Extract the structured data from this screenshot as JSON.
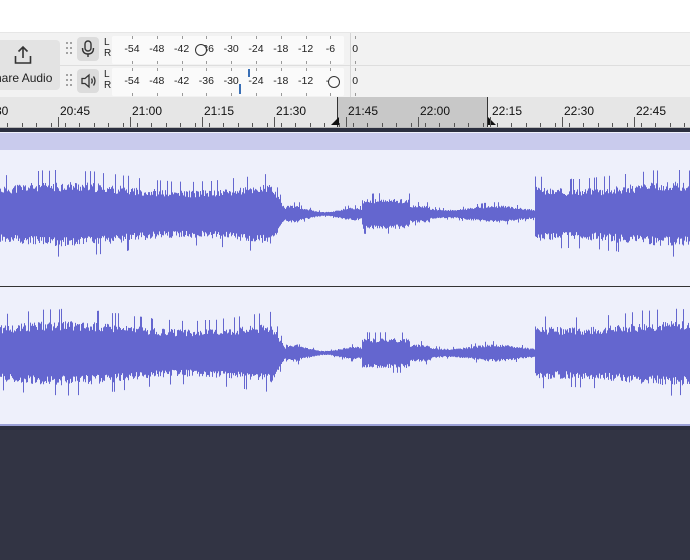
{
  "toolbar": {
    "share_label": "hare Audio",
    "icons": {
      "share": "share-upload-icon",
      "record_meter": "microphone-icon",
      "playback_meter": "speaker-icon"
    },
    "record_meter": {
      "channel_l": "L",
      "channel_r": "R",
      "ticks": [
        "-54",
        "-48",
        "-42",
        "-36",
        "-30",
        "-24",
        "-18",
        "-12",
        "-6",
        "0"
      ]
    },
    "playback_meter": {
      "channel_l": "L",
      "channel_r": "R",
      "ticks": [
        "-54",
        "-48",
        "-42",
        "-36",
        "-30",
        "-24",
        "-18",
        "-12",
        "-6",
        "0"
      ]
    }
  },
  "ruler": {
    "labels": [
      "30",
      "20:45",
      "21:00",
      "21:15",
      "21:30",
      "21:45",
      "22:00",
      "22:15",
      "22:30",
      "22:45"
    ],
    "selection": {
      "start": "21:45",
      "end": "22:15"
    }
  },
  "colors": {
    "waveform": "#6466cf",
    "track_background": "#eef0fb",
    "track_header": "#c9cbed",
    "selection": "#c8c8c8",
    "empty_area": "#323444"
  }
}
